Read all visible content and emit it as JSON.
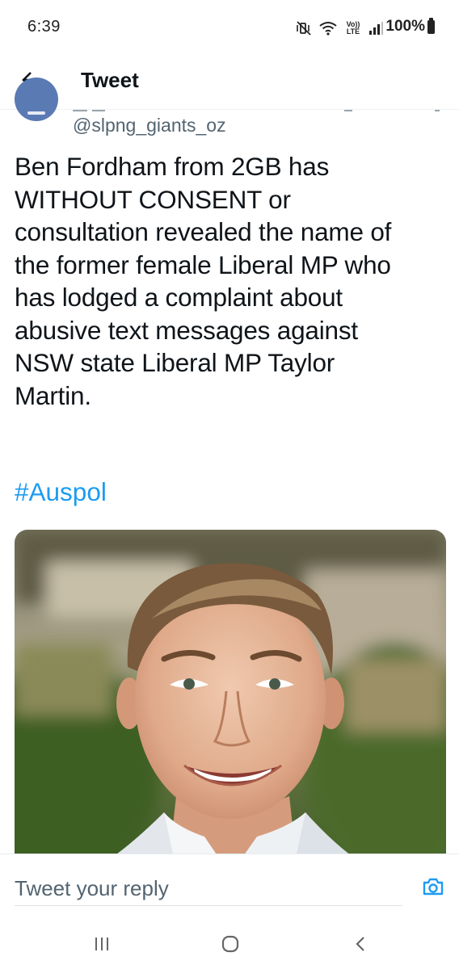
{
  "status_bar": {
    "time": "6:39",
    "network_label": "Vo)) LTE",
    "battery": "100%",
    "icons": [
      "mute-vibrate-icon",
      "wifi-icon",
      "volte-lte-icon",
      "signal-icon",
      "battery-icon"
    ]
  },
  "header": {
    "title": "Tweet",
    "back_icon": "arrow-left-icon"
  },
  "tweet": {
    "handle": "@slpng_giants_oz",
    "text": "Ben Fordham from 2GB has\nWITHOUT CONSENT or\nconsultation revealed the name of\nthe former female Liberal MP who\nhas lodged a complaint about\nabusive text messages against\nNSW state Liberal MP Taylor\nMartin.",
    "hashtag": "#Auspol",
    "media_icon": "photo-of-smiling-man"
  },
  "reply": {
    "placeholder": "Tweet your reply",
    "camera_icon": "camera-icon"
  },
  "nav": {
    "recent_icon": "recent-apps-icon",
    "home_icon": "home-icon",
    "back_icon": "back-chevron-icon"
  },
  "colors": {
    "accent": "#1d9bf0",
    "text_primary": "#0f1419",
    "text_secondary": "#536471"
  }
}
